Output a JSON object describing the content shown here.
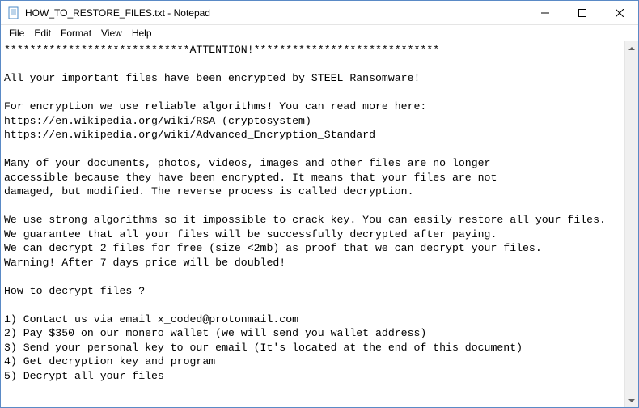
{
  "titlebar": {
    "title": "HOW_TO_RESTORE_FILES.txt - Notepad"
  },
  "menubar": {
    "file": "File",
    "edit": "Edit",
    "format": "Format",
    "view": "View",
    "help": "Help"
  },
  "content": {
    "text": "*****************************ATTENTION!*****************************\n\nAll your important files have been encrypted by STEEL Ransomware!\n\nFor encryption we use reliable algorithms! You can read more here:\nhttps://en.wikipedia.org/wiki/RSA_(cryptosystem)\nhttps://en.wikipedia.org/wiki/Advanced_Encryption_Standard\n\nMany of your documents, photos, videos, images and other files are no longer\naccessible because they have been encrypted. It means that your files are not\ndamaged, but modified. The reverse process is called decryption.\n\nWe use strong algorithms so it impossible to crack key. You can easily restore all your files.\nWe guarantee that all your files will be successfully decrypted after paying.\nWe can decrypt 2 files for free (size <2mb) as proof that we can decrypt your files.\nWarning! After 7 days price will be doubled!\n\nHow to decrypt files ?\n\n1) Contact us via email x_coded@protonmail.com\n2) Pay $350 on our monero wallet (we will send you wallet address)\n3) Send your personal key to our email (It's located at the end of this document)\n4) Get decryption key and program\n5) Decrypt all your files"
  }
}
